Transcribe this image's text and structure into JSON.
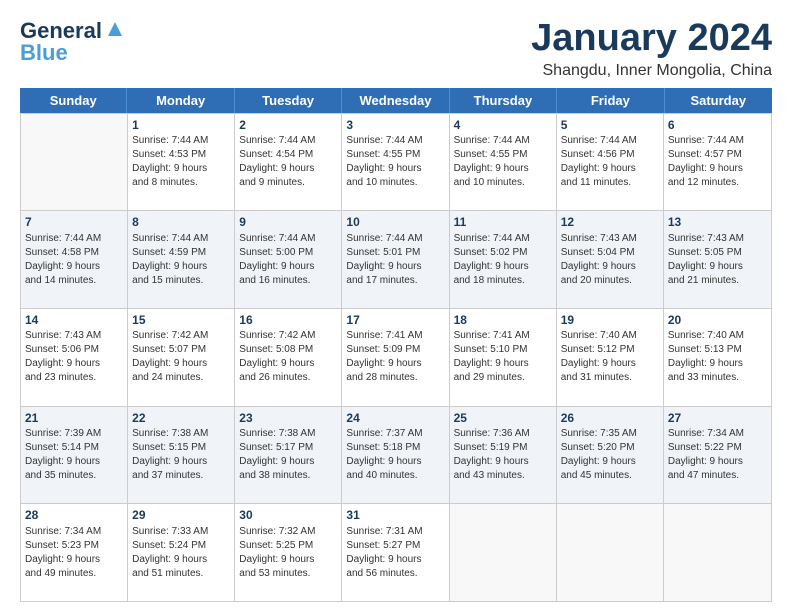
{
  "logo": {
    "line1": "General",
    "line2": "Blue"
  },
  "title": "January 2024",
  "location": "Shangdu, Inner Mongolia, China",
  "weekdays": [
    "Sunday",
    "Monday",
    "Tuesday",
    "Wednesday",
    "Thursday",
    "Friday",
    "Saturday"
  ],
  "rows": [
    [
      {
        "day": "",
        "sunrise": "",
        "sunset": "",
        "daylight": "",
        "empty": true
      },
      {
        "day": "1",
        "sunrise": "Sunrise: 7:44 AM",
        "sunset": "Sunset: 4:53 PM",
        "daylight": "Daylight: 9 hours and 8 minutes."
      },
      {
        "day": "2",
        "sunrise": "Sunrise: 7:44 AM",
        "sunset": "Sunset: 4:54 PM",
        "daylight": "Daylight: 9 hours and 9 minutes."
      },
      {
        "day": "3",
        "sunrise": "Sunrise: 7:44 AM",
        "sunset": "Sunset: 4:55 PM",
        "daylight": "Daylight: 9 hours and 10 minutes."
      },
      {
        "day": "4",
        "sunrise": "Sunrise: 7:44 AM",
        "sunset": "Sunset: 4:55 PM",
        "daylight": "Daylight: 9 hours and 10 minutes."
      },
      {
        "day": "5",
        "sunrise": "Sunrise: 7:44 AM",
        "sunset": "Sunset: 4:56 PM",
        "daylight": "Daylight: 9 hours and 11 minutes."
      },
      {
        "day": "6",
        "sunrise": "Sunrise: 7:44 AM",
        "sunset": "Sunset: 4:57 PM",
        "daylight": "Daylight: 9 hours and 12 minutes."
      }
    ],
    [
      {
        "day": "7",
        "sunrise": "Sunrise: 7:44 AM",
        "sunset": "Sunset: 4:58 PM",
        "daylight": "Daylight: 9 hours and 14 minutes."
      },
      {
        "day": "8",
        "sunrise": "Sunrise: 7:44 AM",
        "sunset": "Sunset: 4:59 PM",
        "daylight": "Daylight: 9 hours and 15 minutes."
      },
      {
        "day": "9",
        "sunrise": "Sunrise: 7:44 AM",
        "sunset": "Sunset: 5:00 PM",
        "daylight": "Daylight: 9 hours and 16 minutes."
      },
      {
        "day": "10",
        "sunrise": "Sunrise: 7:44 AM",
        "sunset": "Sunset: 5:01 PM",
        "daylight": "Daylight: 9 hours and 17 minutes."
      },
      {
        "day": "11",
        "sunrise": "Sunrise: 7:44 AM",
        "sunset": "Sunset: 5:02 PM",
        "daylight": "Daylight: 9 hours and 18 minutes."
      },
      {
        "day": "12",
        "sunrise": "Sunrise: 7:43 AM",
        "sunset": "Sunset: 5:04 PM",
        "daylight": "Daylight: 9 hours and 20 minutes."
      },
      {
        "day": "13",
        "sunrise": "Sunrise: 7:43 AM",
        "sunset": "Sunset: 5:05 PM",
        "daylight": "Daylight: 9 hours and 21 minutes."
      }
    ],
    [
      {
        "day": "14",
        "sunrise": "Sunrise: 7:43 AM",
        "sunset": "Sunset: 5:06 PM",
        "daylight": "Daylight: 9 hours and 23 minutes."
      },
      {
        "day": "15",
        "sunrise": "Sunrise: 7:42 AM",
        "sunset": "Sunset: 5:07 PM",
        "daylight": "Daylight: 9 hours and 24 minutes."
      },
      {
        "day": "16",
        "sunrise": "Sunrise: 7:42 AM",
        "sunset": "Sunset: 5:08 PM",
        "daylight": "Daylight: 9 hours and 26 minutes."
      },
      {
        "day": "17",
        "sunrise": "Sunrise: 7:41 AM",
        "sunset": "Sunset: 5:09 PM",
        "daylight": "Daylight: 9 hours and 28 minutes."
      },
      {
        "day": "18",
        "sunrise": "Sunrise: 7:41 AM",
        "sunset": "Sunset: 5:10 PM",
        "daylight": "Daylight: 9 hours and 29 minutes."
      },
      {
        "day": "19",
        "sunrise": "Sunrise: 7:40 AM",
        "sunset": "Sunset: 5:12 PM",
        "daylight": "Daylight: 9 hours and 31 minutes."
      },
      {
        "day": "20",
        "sunrise": "Sunrise: 7:40 AM",
        "sunset": "Sunset: 5:13 PM",
        "daylight": "Daylight: 9 hours and 33 minutes."
      }
    ],
    [
      {
        "day": "21",
        "sunrise": "Sunrise: 7:39 AM",
        "sunset": "Sunset: 5:14 PM",
        "daylight": "Daylight: 9 hours and 35 minutes."
      },
      {
        "day": "22",
        "sunrise": "Sunrise: 7:38 AM",
        "sunset": "Sunset: 5:15 PM",
        "daylight": "Daylight: 9 hours and 37 minutes."
      },
      {
        "day": "23",
        "sunrise": "Sunrise: 7:38 AM",
        "sunset": "Sunset: 5:17 PM",
        "daylight": "Daylight: 9 hours and 38 minutes."
      },
      {
        "day": "24",
        "sunrise": "Sunrise: 7:37 AM",
        "sunset": "Sunset: 5:18 PM",
        "daylight": "Daylight: 9 hours and 40 minutes."
      },
      {
        "day": "25",
        "sunrise": "Sunrise: 7:36 AM",
        "sunset": "Sunset: 5:19 PM",
        "daylight": "Daylight: 9 hours and 43 minutes."
      },
      {
        "day": "26",
        "sunrise": "Sunrise: 7:35 AM",
        "sunset": "Sunset: 5:20 PM",
        "daylight": "Daylight: 9 hours and 45 minutes."
      },
      {
        "day": "27",
        "sunrise": "Sunrise: 7:34 AM",
        "sunset": "Sunset: 5:22 PM",
        "daylight": "Daylight: 9 hours and 47 minutes."
      }
    ],
    [
      {
        "day": "28",
        "sunrise": "Sunrise: 7:34 AM",
        "sunset": "Sunset: 5:23 PM",
        "daylight": "Daylight: 9 hours and 49 minutes."
      },
      {
        "day": "29",
        "sunrise": "Sunrise: 7:33 AM",
        "sunset": "Sunset: 5:24 PM",
        "daylight": "Daylight: 9 hours and 51 minutes."
      },
      {
        "day": "30",
        "sunrise": "Sunrise: 7:32 AM",
        "sunset": "Sunset: 5:25 PM",
        "daylight": "Daylight: 9 hours and 53 minutes."
      },
      {
        "day": "31",
        "sunrise": "Sunrise: 7:31 AM",
        "sunset": "Sunset: 5:27 PM",
        "daylight": "Daylight: 9 hours and 56 minutes."
      },
      {
        "day": "",
        "sunrise": "",
        "sunset": "",
        "daylight": "",
        "empty": true
      },
      {
        "day": "",
        "sunrise": "",
        "sunset": "",
        "daylight": "",
        "empty": true
      },
      {
        "day": "",
        "sunrise": "",
        "sunset": "",
        "daylight": "",
        "empty": true
      }
    ]
  ],
  "colors": {
    "header_bg": "#2f6db5",
    "header_text": "#ffffff",
    "title_color": "#1a3a5c",
    "row_shaded": "#f0f4f8",
    "border": "#cccccc"
  }
}
